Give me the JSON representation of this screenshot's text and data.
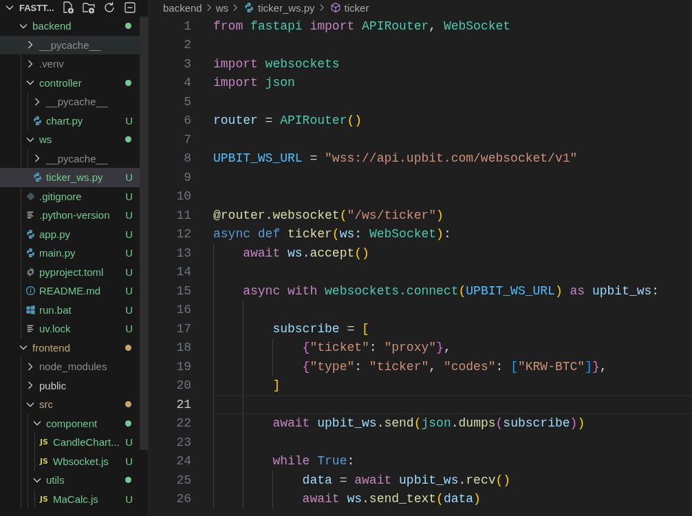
{
  "explorer": {
    "title": "FASTT...",
    "expanded": true,
    "items": [
      {
        "name": "backend",
        "kind": "folder",
        "expanded": true,
        "color": "#73c991",
        "dot": true,
        "selected": false,
        "hovered": false,
        "children": [
          {
            "name": "__pycache__",
            "kind": "folder",
            "expanded": false,
            "color": "#8c8c8c",
            "dot": false,
            "selected": false,
            "hovered": true
          },
          {
            "name": ".venv",
            "kind": "folder",
            "expanded": false,
            "color": "#8c8c8c",
            "dot": false,
            "selected": false,
            "hovered": false
          },
          {
            "name": "controller",
            "kind": "folder",
            "expanded": true,
            "color": "#73c991",
            "dot": true,
            "selected": false,
            "hovered": false,
            "children": [
              {
                "name": "__pycache__",
                "kind": "folder",
                "expanded": false,
                "color": "#8c8c8c",
                "dot": false,
                "selected": false,
                "hovered": false
              },
              {
                "name": "chart.py",
                "kind": "python",
                "color": "#73c991",
                "badge": "U",
                "selected": false,
                "hovered": false
              }
            ]
          },
          {
            "name": "ws",
            "kind": "folder",
            "expanded": true,
            "color": "#73c991",
            "dot": true,
            "selected": false,
            "hovered": false,
            "children": [
              {
                "name": "__pycache__",
                "kind": "folder",
                "expanded": false,
                "color": "#8c8c8c",
                "dot": false,
                "selected": false,
                "hovered": false
              },
              {
                "name": "ticker_ws.py",
                "kind": "python",
                "color": "#73c991",
                "badge": "U",
                "selected": true,
                "hovered": false
              }
            ]
          },
          {
            "name": ".gitignore",
            "kind": "git",
            "color": "#73c991",
            "badge": "U",
            "selected": false,
            "hovered": false
          },
          {
            "name": ".python-version",
            "kind": "text",
            "color": "#73c991",
            "badge": "U",
            "selected": false,
            "hovered": false
          },
          {
            "name": "app.py",
            "kind": "python",
            "color": "#73c991",
            "badge": "U",
            "selected": false,
            "hovered": false
          },
          {
            "name": "main.py",
            "kind": "python",
            "color": "#73c991",
            "badge": "U",
            "selected": false,
            "hovered": false
          },
          {
            "name": "pyproject.toml",
            "kind": "settings",
            "color": "#73c991",
            "badge": "U",
            "selected": false,
            "hovered": false
          },
          {
            "name": "README.md",
            "kind": "info",
            "color": "#73c991",
            "badge": "U",
            "selected": false,
            "hovered": false
          },
          {
            "name": "run.bat",
            "kind": "windows",
            "color": "#73c991",
            "badge": "U",
            "selected": false,
            "hovered": false
          },
          {
            "name": "uv.lock",
            "kind": "text",
            "color": "#73c991",
            "badge": "U",
            "selected": false,
            "hovered": false
          }
        ]
      },
      {
        "name": "frontend",
        "kind": "folder",
        "expanded": true,
        "color": "#c5a773",
        "dot": true,
        "selected": false,
        "hovered": false,
        "children": [
          {
            "name": "node_modules",
            "kind": "folder",
            "expanded": false,
            "color": "#8c8c8c",
            "dot": false,
            "selected": false,
            "hovered": false
          },
          {
            "name": "public",
            "kind": "folder",
            "expanded": false,
            "color": "#cccccc",
            "dot": false,
            "selected": false,
            "hovered": false
          },
          {
            "name": "src",
            "kind": "folder",
            "expanded": true,
            "color": "#c5a773",
            "dot": true,
            "selected": false,
            "hovered": false,
            "children": [
              {
                "name": "component",
                "kind": "folder",
                "expanded": true,
                "color": "#73c991",
                "dot": true,
                "selected": false,
                "hovered": false,
                "children": [
                  {
                    "name": "CandleChart...",
                    "kind": "js",
                    "icon_label": "JS",
                    "color": "#73c991",
                    "badge": "U",
                    "selected": false,
                    "hovered": false
                  },
                  {
                    "name": "Wbsocket.js",
                    "kind": "js",
                    "icon_label": "JS",
                    "color": "#73c991",
                    "badge": "U",
                    "selected": false,
                    "hovered": false
                  }
                ]
              },
              {
                "name": "utils",
                "kind": "folder",
                "expanded": true,
                "color": "#73c991",
                "dot": true,
                "selected": false,
                "hovered": false,
                "children": [
                  {
                    "name": "MaCalc.js",
                    "kind": "js",
                    "icon_label": "JS",
                    "color": "#73c991",
                    "badge": "U",
                    "selected": false,
                    "hovered": false
                  }
                ]
              }
            ]
          }
        ]
      }
    ]
  },
  "breadcrumbs": [
    {
      "label": "backend",
      "kind": "folder"
    },
    {
      "label": "ws",
      "kind": "folder"
    },
    {
      "label": "ticker_ws.py",
      "kind": "python"
    },
    {
      "label": "ticker",
      "kind": "symbol"
    }
  ],
  "code_lines": [
    {
      "number": "1",
      "active": false,
      "tokens": [
        {
          "kind": "keyword",
          "text": "from"
        },
        {
          "kind": "type",
          "text": " fastapi"
        },
        {
          "kind": "keyword",
          "text": " import"
        },
        {
          "kind": "type",
          "text": " APIRouter"
        },
        {
          "kind": "plain",
          "text": ", "
        },
        {
          "kind": "type",
          "text": "WebSocket"
        }
      ]
    },
    {
      "number": "2",
      "active": false
    },
    {
      "number": "3",
      "active": false,
      "tokens": [
        {
          "kind": "keyword",
          "text": "import"
        },
        {
          "kind": "type",
          "text": " websockets"
        }
      ]
    },
    {
      "number": "4",
      "active": false,
      "tokens": [
        {
          "kind": "keyword",
          "text": "import"
        },
        {
          "kind": "type",
          "text": " json"
        }
      ]
    },
    {
      "number": "5",
      "active": false
    },
    {
      "number": "6",
      "active": false,
      "tokens": [
        {
          "kind": "variable",
          "text": "router"
        },
        {
          "kind": "plain",
          "text": " = "
        },
        {
          "kind": "type",
          "text": "APIRouter"
        },
        {
          "kind": "bracket1",
          "text": "()"
        }
      ]
    },
    {
      "number": "7",
      "active": false
    },
    {
      "number": "8",
      "active": false,
      "tokens": [
        {
          "kind": "constant",
          "text": "UPBIT_WS_URL"
        },
        {
          "kind": "plain",
          "text": " = "
        },
        {
          "kind": "string",
          "text": "\"wss://api.upbit.com/websocket/v1\""
        }
      ]
    },
    {
      "number": "9",
      "active": false
    },
    {
      "number": "10",
      "active": false
    },
    {
      "number": "11",
      "active": false,
      "tokens": [
        {
          "kind": "function",
          "text": "@router.websocket"
        },
        {
          "kind": "bracket1",
          "text": "("
        },
        {
          "kind": "string",
          "text": "\"/ws/ticker\""
        },
        {
          "kind": "bracket1",
          "text": ")"
        }
      ]
    },
    {
      "number": "12",
      "active": false,
      "tokens": [
        {
          "kind": "storage",
          "text": "async"
        },
        {
          "kind": "storage",
          "text": " def"
        },
        {
          "kind": "function",
          "text": " ticker"
        },
        {
          "kind": "bracket1",
          "text": "("
        },
        {
          "kind": "variable",
          "text": "ws"
        },
        {
          "kind": "plain",
          "text": ": "
        },
        {
          "kind": "type",
          "text": "WebSocket"
        },
        {
          "kind": "bracket1",
          "text": ")"
        },
        {
          "kind": "plain",
          "text": ":"
        }
      ]
    },
    {
      "number": "13",
      "active": false,
      "tokens": [
        {
          "kind": "keyword",
          "text": "    await"
        },
        {
          "kind": "variable",
          "text": " ws"
        },
        {
          "kind": "plain",
          "text": "."
        },
        {
          "kind": "function",
          "text": "accept"
        },
        {
          "kind": "bracket1",
          "text": "()"
        }
      ]
    },
    {
      "number": "14",
      "active": false
    },
    {
      "number": "15",
      "active": false,
      "tokens": [
        {
          "kind": "keyword",
          "text": "    async with"
        },
        {
          "kind": "type",
          "text": " websockets.connect"
        },
        {
          "kind": "bracket1",
          "text": "("
        },
        {
          "kind": "constant",
          "text": "UPBIT_WS_URL"
        },
        {
          "kind": "bracket1",
          "text": ")"
        },
        {
          "kind": "keyword",
          "text": " as"
        },
        {
          "kind": "variable",
          "text": " upbit_ws"
        },
        {
          "kind": "plain",
          "text": ":"
        }
      ]
    },
    {
      "number": "16",
      "active": false
    },
    {
      "number": "17",
      "active": false,
      "tokens": [
        {
          "kind": "variable",
          "text": "        subscribe"
        },
        {
          "kind": "plain",
          "text": " = "
        },
        {
          "kind": "bracket1",
          "text": "["
        }
      ]
    },
    {
      "number": "18",
      "active": false,
      "tokens": [
        {
          "kind": "bracket2",
          "text": "            {"
        },
        {
          "kind": "string",
          "text": "\"ticket\""
        },
        {
          "kind": "plain",
          "text": ": "
        },
        {
          "kind": "string",
          "text": "\"proxy\""
        },
        {
          "kind": "bracket2",
          "text": "}"
        },
        {
          "kind": "plain",
          "text": ","
        }
      ]
    },
    {
      "number": "19",
      "active": false,
      "tokens": [
        {
          "kind": "bracket2",
          "text": "            {"
        },
        {
          "kind": "string",
          "text": "\"type\""
        },
        {
          "kind": "plain",
          "text": ": "
        },
        {
          "kind": "string",
          "text": "\"ticker\""
        },
        {
          "kind": "plain",
          "text": ", "
        },
        {
          "kind": "string",
          "text": "\"codes\""
        },
        {
          "kind": "plain",
          "text": ": "
        },
        {
          "kind": "bracket3",
          "text": "["
        },
        {
          "kind": "string",
          "text": "\"KRW-BTC\""
        },
        {
          "kind": "bracket3",
          "text": "]"
        },
        {
          "kind": "bracket2",
          "text": "}"
        },
        {
          "kind": "plain",
          "text": ","
        }
      ]
    },
    {
      "number": "20",
      "active": false,
      "tokens": [
        {
          "kind": "bracket1",
          "text": "        ]"
        }
      ]
    },
    {
      "number": "21",
      "active": true
    },
    {
      "number": "22",
      "active": false,
      "tokens": [
        {
          "kind": "keyword",
          "text": "        await"
        },
        {
          "kind": "variable",
          "text": " upbit_ws"
        },
        {
          "kind": "plain",
          "text": "."
        },
        {
          "kind": "function",
          "text": "send"
        },
        {
          "kind": "bracket1",
          "text": "("
        },
        {
          "kind": "type",
          "text": "json"
        },
        {
          "kind": "plain",
          "text": "."
        },
        {
          "kind": "function",
          "text": "dumps"
        },
        {
          "kind": "bracket2",
          "text": "("
        },
        {
          "kind": "variable",
          "text": "subscribe"
        },
        {
          "kind": "bracket2",
          "text": ")"
        },
        {
          "kind": "bracket1",
          "text": ")"
        }
      ]
    },
    {
      "number": "23",
      "active": false
    },
    {
      "number": "24",
      "active": false,
      "tokens": [
        {
          "kind": "keyword",
          "text": "        while"
        },
        {
          "kind": "storage",
          "text": " True"
        },
        {
          "kind": "plain",
          "text": ":"
        }
      ]
    },
    {
      "number": "25",
      "active": false,
      "tokens": [
        {
          "kind": "variable",
          "text": "            data"
        },
        {
          "kind": "plain",
          "text": " = "
        },
        {
          "kind": "keyword",
          "text": "await"
        },
        {
          "kind": "variable",
          "text": " upbit_ws"
        },
        {
          "kind": "plain",
          "text": "."
        },
        {
          "kind": "function",
          "text": "recv"
        },
        {
          "kind": "bracket1",
          "text": "()"
        }
      ]
    },
    {
      "number": "26",
      "active": false,
      "tokens": [
        {
          "kind": "keyword",
          "text": "            await"
        },
        {
          "kind": "variable",
          "text": " ws"
        },
        {
          "kind": "plain",
          "text": "."
        },
        {
          "kind": "function",
          "text": "send_text"
        },
        {
          "kind": "bracket1",
          "text": "("
        },
        {
          "kind": "variable",
          "text": "data"
        },
        {
          "kind": "bracket1",
          "text": ")"
        }
      ]
    }
  ]
}
